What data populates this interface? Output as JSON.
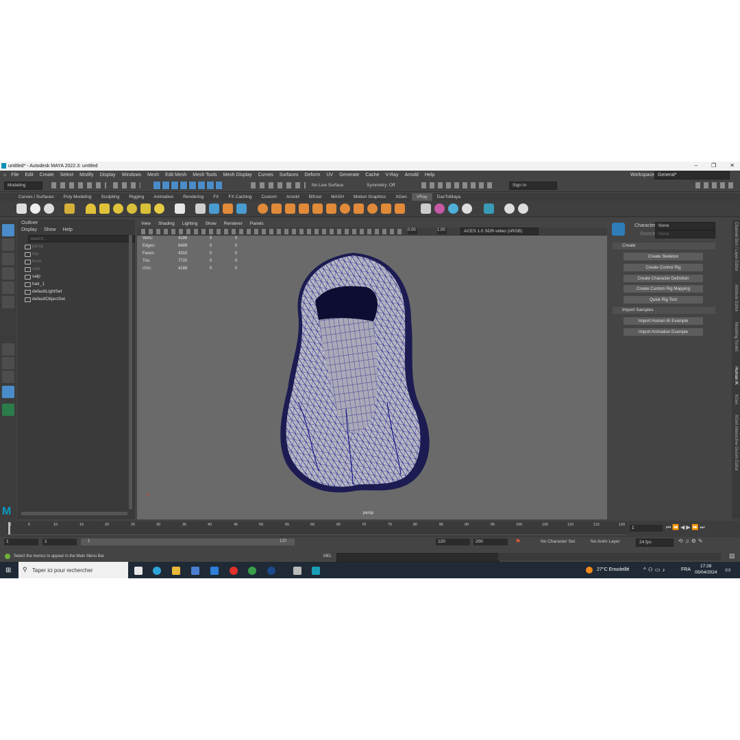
{
  "window": {
    "title": "untitled* - Autodesk MAYA 2022.3: untitled",
    "controls": [
      "–",
      "❐",
      "✕"
    ]
  },
  "menubar": {
    "items": [
      "File",
      "Edit",
      "Create",
      "Select",
      "Modify",
      "Display",
      "Windows",
      "Mesh",
      "Edit Mesh",
      "Mesh Tools",
      "Mesh Display",
      "Curves",
      "Surfaces",
      "Deform",
      "UV",
      "Generate",
      "Cache",
      "V-Ray",
      "Arnold",
      "Help"
    ],
    "workspace_label": "Workspace:",
    "workspace_value": "General*"
  },
  "statusline": {
    "mode": "Modeling",
    "live_surface": "No Live Surface",
    "symmetry": "Symmetry: Off",
    "sign_in": "Sign In"
  },
  "shelf": {
    "tabs": [
      "Curves / Surfaces",
      "Poly Modeling",
      "Sculpting",
      "Rigging",
      "Animation",
      "Rendering",
      "FX",
      "FX Caching",
      "Custom",
      "Arnold",
      "Bifrost",
      "MASH",
      "Motion Graphics",
      "XGen",
      "VRay",
      "DazToMaya"
    ],
    "active_tab": "VRay"
  },
  "outliner": {
    "title": "Outliner",
    "menu": [
      "Display",
      "Show",
      "Help"
    ],
    "search_placeholder": "Search...",
    "items": [
      {
        "label": "persp",
        "dim": true
      },
      {
        "label": "top",
        "dim": true
      },
      {
        "label": "front",
        "dim": true
      },
      {
        "label": "side",
        "dim": true
      },
      {
        "label": "salp",
        "dim": false
      },
      {
        "label": "hair_1",
        "dim": false
      },
      {
        "label": "defaultLightSet",
        "dim": false
      },
      {
        "label": "defaultObjectSet",
        "dim": false
      }
    ]
  },
  "viewport": {
    "menu": [
      "View",
      "Shading",
      "Lighting",
      "Show",
      "Renderer",
      "Panels"
    ],
    "field_a": "0.00",
    "field_b": "1.00",
    "color_space": "ACES 1.0 SDR-video (sRGB)",
    "camera": "persp",
    "hud": [
      {
        "label": "Verts:",
        "a": "4186",
        "b": "0",
        "c": "0"
      },
      {
        "label": "Edges:",
        "a": "8489",
        "b": "0",
        "c": "0"
      },
      {
        "label": "Faces:",
        "a": "4310",
        "b": "0",
        "c": "0"
      },
      {
        "label": "Tris:",
        "a": "7720",
        "b": "0",
        "c": "0"
      },
      {
        "label": "UVs:",
        "a": "4186",
        "b": "0",
        "c": "0"
      }
    ]
  },
  "humanik": {
    "character_label": "Character:",
    "character_value": "None",
    "source_label": "Source:",
    "source_value": "None",
    "create_section": "Create",
    "create_buttons": [
      "Create Skeleton",
      "Create Control Rig",
      "Create Character Definition",
      "Create Custom Rig Mapping",
      "Quick Rig Tool"
    ],
    "import_section": "Import Samples",
    "import_buttons": [
      "Import Human IK Example",
      "Import Animation Example"
    ]
  },
  "side_tabs": [
    "Channel Box / Layer Editor",
    "Attribute Editor",
    "Modeling Toolkit",
    "Human IK",
    "XGen",
    "XGen Interactive Groom Editor"
  ],
  "timeslider": {
    "ticks": [
      "1",
      "5",
      "10",
      "15",
      "20",
      "25",
      "30",
      "35",
      "40",
      "45",
      "50",
      "55",
      "60",
      "65",
      "70",
      "75",
      "80",
      "85",
      "90",
      "95",
      "100",
      "105",
      "110",
      "115",
      "120"
    ],
    "current_frame": "1"
  },
  "range": {
    "start": "1",
    "inner_start": "1",
    "slider_start": "1",
    "slider_end": "120",
    "end": "120",
    "anim_end": "200",
    "char_set": "No Character Set",
    "anim_layer": "No Anim Layer",
    "fps": "24 fps"
  },
  "helpline": {
    "text": "Select the menus to appear in the Main Menu Bar",
    "mel": "MEL"
  },
  "taskbar": {
    "search": "Taper ici pour rechercher",
    "weather": "27°C  Ensoleillé",
    "lang": "FRA",
    "time": "17:28",
    "date": "05/04/2024"
  },
  "colors": {
    "wire": "#1a1a8a",
    "accent": "#4a8cc9",
    "bg": "#444444"
  }
}
